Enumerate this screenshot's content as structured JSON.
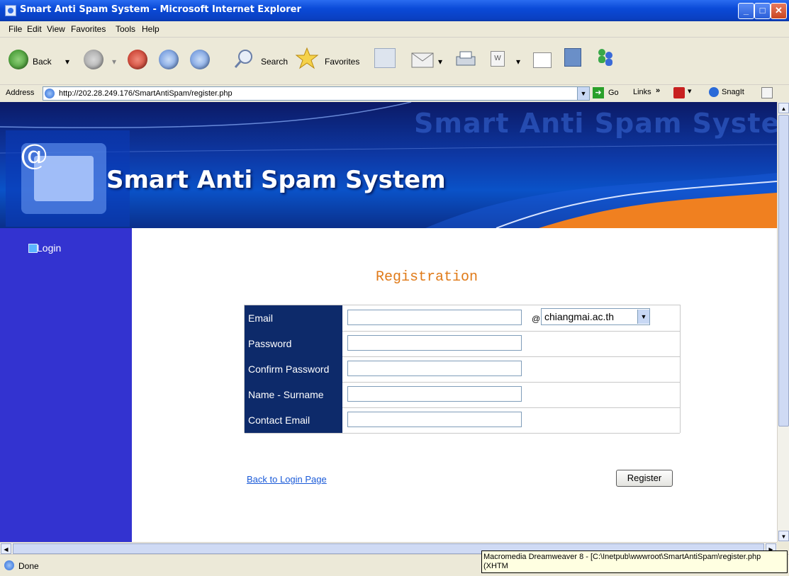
{
  "window": {
    "title": "Smart Anti Spam System - Microsoft Internet Explorer"
  },
  "menu": [
    "File",
    "Edit",
    "View",
    "Favorites",
    "Tools",
    "Help"
  ],
  "toolbar": {
    "back": "Back",
    "search": "Search",
    "favorites": "Favorites"
  },
  "address": {
    "label": "Address",
    "url": "http://202.28.249.176/SmartAntiSpam/register.php",
    "go": "Go",
    "links": "Links",
    "snagit": "SnagIt"
  },
  "banner": {
    "title": "Smart Anti Spam System",
    "watermark": "Smart Anti Spam System",
    "at": "@"
  },
  "sidebar": {
    "login": "Login"
  },
  "form": {
    "heading": "Registration",
    "rows": [
      {
        "label": "Email",
        "value": ""
      },
      {
        "label": "Password",
        "value": ""
      },
      {
        "label": "Confirm Password",
        "value": ""
      },
      {
        "label": "Name - Surname",
        "value": ""
      },
      {
        "label": "Contact Email",
        "value": ""
      }
    ],
    "at_sign": "@",
    "domain_selected": "chiangmai.ac.th",
    "back_link": "Back to Login Page",
    "register_button": "Register"
  },
  "status": {
    "text": "Done",
    "tooltip": "Macromedia Dreamweaver 8 - [C:\\Inetpub\\wwwroot\\SmartAntiSpam\\register.php (XHTM"
  },
  "colors": {
    "sidebar": "#3333d0",
    "label_bg": "#0d2a6a",
    "heading": "#e07a18",
    "titlebar": "#0a4ad8"
  }
}
